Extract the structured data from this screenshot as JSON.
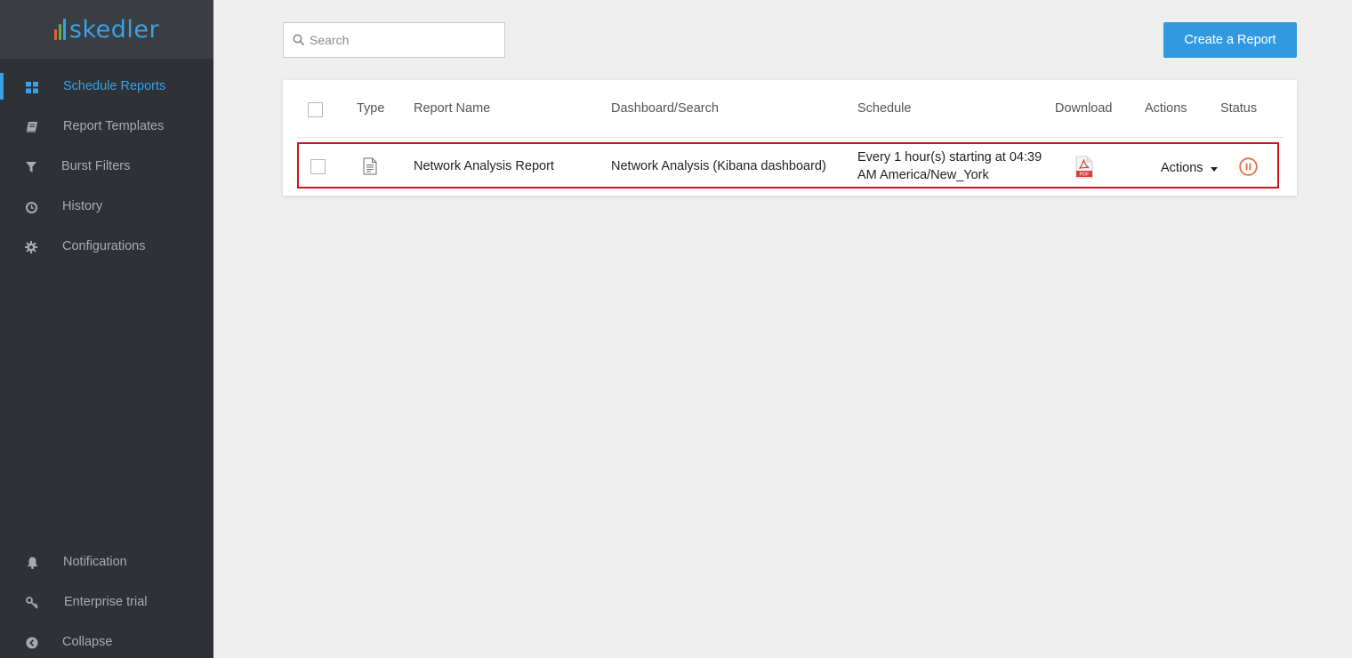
{
  "app": {
    "logo_text": "skedler",
    "logo_bar_colors": [
      "#e25f3a",
      "#5ab34a",
      "#3aa1e6"
    ]
  },
  "sidebar": {
    "items": [
      {
        "label": "Schedule Reports",
        "icon": "grid-icon",
        "active": true
      },
      {
        "label": "Report Templates",
        "icon": "book-icon",
        "active": false
      },
      {
        "label": "Burst Filters",
        "icon": "filter-icon",
        "active": false
      },
      {
        "label": "History",
        "icon": "clock-icon",
        "active": false
      },
      {
        "label": "Configurations",
        "icon": "gear-icon",
        "active": false
      }
    ],
    "bottom_items": [
      {
        "label": "Notification",
        "icon": "bell-icon"
      },
      {
        "label": "Enterprise trial",
        "icon": "key-icon"
      },
      {
        "label": "Collapse",
        "icon": "chevron-left-circle-icon"
      }
    ]
  },
  "toolbar": {
    "search_placeholder": "Search",
    "create_label": "Create a Report"
  },
  "table": {
    "columns": [
      "Type",
      "Report Name",
      "Dashboard/Search",
      "Schedule",
      "Download",
      "Actions",
      "Status"
    ],
    "rows": [
      {
        "type_icon": "document-icon",
        "report_name": "Network Analysis Report",
        "dashboard": "Network Analysis (Kibana dashboard)",
        "schedule_line1": "Every 1 hour(s) starting at 04:39",
        "schedule_line2": "AM America/New_York",
        "download_icon": "pdf-icon",
        "download_badge": "PDF",
        "actions_label": "Actions",
        "status_icon": "pause-circle-icon"
      }
    ]
  },
  "colors": {
    "accent": "#3aa1e6",
    "button": "#3199e0",
    "sidebar_bg": "#2e3135",
    "highlight_border": "#d0121f",
    "status_pause": "#e0734a",
    "pdf_red": "#d9403a"
  }
}
